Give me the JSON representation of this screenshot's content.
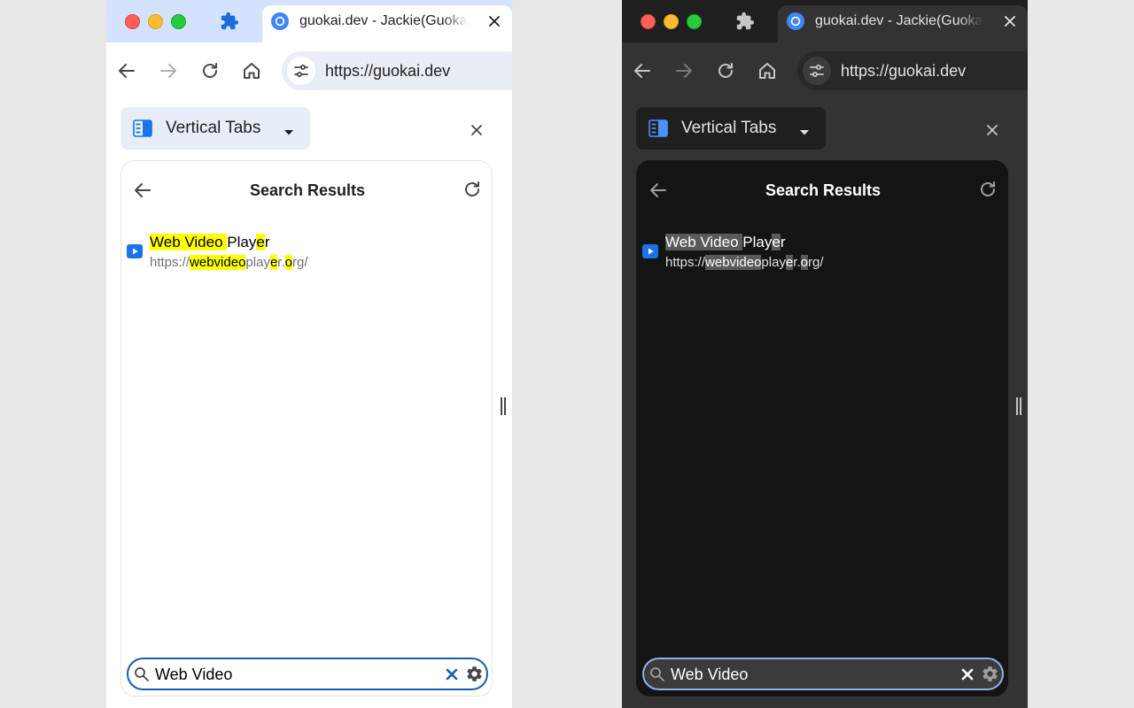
{
  "panels": [
    {
      "theme": "light",
      "tab": {
        "title": "guokai.dev - Jackie(Guokai Han)"
      },
      "omnibox": {
        "url": "https://guokai.dev"
      },
      "side_panel": {
        "selector_label": "Vertical Tabs",
        "results_title": "Search Results",
        "result": {
          "title_segments": [
            {
              "text": "Web Video ",
              "hl": true
            },
            {
              "text": "Play",
              "hl": false
            },
            {
              "text": "e",
              "hl": true
            },
            {
              "text": "r",
              "hl": false
            }
          ],
          "url_segments": [
            {
              "text": "https://",
              "hl": false
            },
            {
              "text": "webvideo",
              "hl": true
            },
            {
              "text": "play",
              "hl": false
            },
            {
              "text": "e",
              "hl": true
            },
            {
              "text": "r.",
              "hl": false
            },
            {
              "text": "o",
              "hl": true
            },
            {
              "text": "rg/",
              "hl": false
            }
          ]
        },
        "search_value": "Web Video"
      }
    },
    {
      "theme": "dark",
      "tab": {
        "title": "guokai.dev - Jackie(Guokai Han)"
      },
      "omnibox": {
        "url": "https://guokai.dev"
      },
      "side_panel": {
        "selector_label": "Vertical Tabs",
        "results_title": "Search Results",
        "result": {
          "title_segments": [
            {
              "text": "Web Video ",
              "hl": true
            },
            {
              "text": "Play",
              "hl": false
            },
            {
              "text": "e",
              "hl": true
            },
            {
              "text": "r",
              "hl": false
            }
          ],
          "url_segments": [
            {
              "text": "https://",
              "hl": false
            },
            {
              "text": "webvideo",
              "hl": true
            },
            {
              "text": "play",
              "hl": false
            },
            {
              "text": "e",
              "hl": true
            },
            {
              "text": "r.",
              "hl": false
            },
            {
              "text": "o",
              "hl": true
            },
            {
              "text": "rg/",
              "hl": false
            }
          ]
        },
        "search_value": "Web Video"
      }
    }
  ],
  "icons": {
    "window_controls": [
      "close-icon",
      "minimize-icon",
      "zoom-icon"
    ],
    "toolbar": [
      "extensions-puzzle-icon",
      "back-icon",
      "forward-icon",
      "reload-icon",
      "home-icon",
      "site-info-icon"
    ],
    "side_panel": [
      "vertical-tabs-icon",
      "caret-down-icon",
      "close-icon",
      "back-arrow-icon",
      "refresh-icon",
      "video-player-favicon",
      "search-icon",
      "clear-icon",
      "gear-icon",
      "resize-handle-icon"
    ]
  },
  "colors": {
    "light_tabstrip": "#d3e3fd",
    "dark_tabstrip": "#1f1f1f",
    "light_highlight": "#ffff00",
    "dark_highlight": "#5a5a5a",
    "light_search_border": "#1a5eb0",
    "dark_search_border": "#8ab4e8",
    "tab_favicon_blue": "#4285f4",
    "sidepanel_icon_blue": "#1a73e8"
  }
}
